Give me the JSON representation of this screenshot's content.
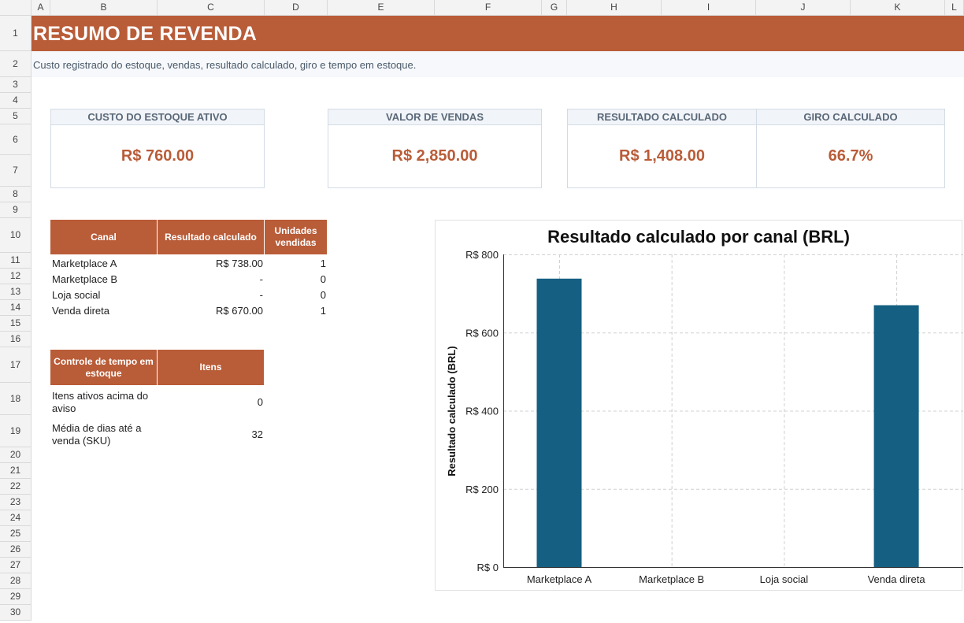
{
  "sheet": {
    "columns": [
      "A",
      "B",
      "C",
      "D",
      "E",
      "F",
      "G",
      "H",
      "I",
      "J",
      "K",
      "L"
    ],
    "rows": [
      "1",
      "2",
      "3",
      "4",
      "5",
      "6",
      "7",
      "8",
      "9",
      "10",
      "11",
      "12",
      "13",
      "14",
      "15",
      "16",
      "17",
      "18",
      "19",
      "20",
      "21",
      "22",
      "23",
      "24",
      "25",
      "26",
      "27",
      "28",
      "29",
      "30"
    ]
  },
  "header": {
    "title": "RESUMO DE REVENDA",
    "subtitle": "Custo registrado do estoque, vendas, resultado calculado, giro e tempo em estoque."
  },
  "kpis": [
    {
      "label": "CUSTO DO ESTOQUE ATIVO",
      "value": "R$ 760.00"
    },
    {
      "label": "VALOR DE VENDAS",
      "value": "R$ 2,850.00"
    },
    {
      "label": "RESULTADO CALCULADO",
      "value": "R$ 1,408.00"
    },
    {
      "label": "GIRO CALCULADO",
      "value": "66.7%"
    }
  ],
  "channel_table": {
    "headers": [
      "Canal",
      "Resultado calculado",
      "Unidades vendidas"
    ],
    "rows": [
      {
        "canal": "Marketplace A",
        "resultado": "R$ 738.00",
        "unidades": "1"
      },
      {
        "canal": "Marketplace B",
        "resultado": "-",
        "unidades": "0"
      },
      {
        "canal": "Loja social",
        "resultado": "-",
        "unidades": "0"
      },
      {
        "canal": "Venda direta",
        "resultado": "R$ 670.00",
        "unidades": "1"
      }
    ]
  },
  "time_table": {
    "headers": [
      "Controle de tempo em estoque",
      "Itens"
    ],
    "rows": [
      {
        "label": "Itens ativos acima do aviso",
        "value": "0"
      },
      {
        "label": "Média de dias até a venda (SKU)",
        "value": "32"
      }
    ]
  },
  "colors": {
    "accent": "#b95c38",
    "bar": "#155f82",
    "subtitle": "#4a5a6a"
  },
  "chart_data": {
    "type": "bar",
    "title": "Resultado calculado por canal (BRL)",
    "xlabel": "",
    "ylabel": "Resultado calculado (BRL)",
    "categories": [
      "Marketplace A",
      "Marketplace B",
      "Loja social",
      "Venda direta"
    ],
    "values": [
      738,
      0,
      0,
      670
    ],
    "ylim": [
      0,
      800
    ],
    "yticks": [
      0,
      200,
      400,
      600,
      800
    ],
    "ytick_labels": [
      "R$ 0",
      "R$ 200",
      "R$ 400",
      "R$ 600",
      "R$ 800"
    ],
    "grid": true,
    "legend": "none"
  }
}
